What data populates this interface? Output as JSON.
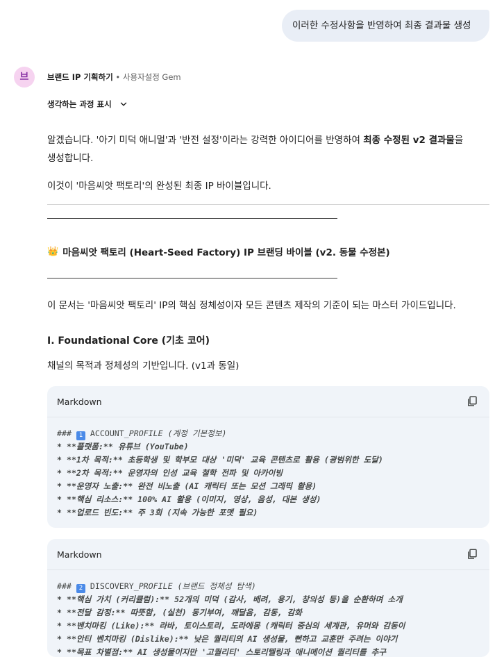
{
  "user_message": "이러한 수정사항을 반영하여 최종 결과물 생성",
  "gem": {
    "avatar_letter": "브",
    "name": "브랜드 IP 기획하기",
    "subtitle": " • 사용자설정 Gem"
  },
  "thinking_toggle": "생각하는 과정 표시",
  "response": {
    "intro_line1_part1": "알겠습니다. '아기 미덕 애니멀'과 '반전 설정'이라는 강력한 아이디어를 반영하여 ",
    "intro_line1_bold": "최종 수정된 v2 결과물",
    "intro_line1_part2": "을",
    "intro_line2": "생성합니다.",
    "intro_line3": "이것이 '마음씨앗 팩토리'의 완성된 최종 IP 바이블입니다.",
    "bible_icon": "crown-icon",
    "bible_title": "마음씨앗 팩토리 (Heart-Seed Factory) IP 브랜딩 바이블 (v2. 동물 수정본)",
    "doc_intro": "이 문서는 '마음씨앗 팩토리' IP의 핵심 정체성이자 모든 콘텐츠 제작의 기준이 되는 마스터 가이드입니다.",
    "section1_title": "Ⅰ. Foundational Core (기초 코어)",
    "section1_desc": "채널의 목적과 정체성의 기반입니다. (v1과 동일)"
  },
  "code_blocks": [
    {
      "lang": "Markdown",
      "heading_prefix": "### ",
      "badge": "1",
      "heading_text": " ACCOUNT_",
      "heading_italic": "PROFILE (계정 기본정보)",
      "lines": [
        "* **플랫폼:** 유튜브 (YouTube)",
        "* **1차 목적:** 초등학생 및 학부모 대상 '미덕' 교육 콘텐츠로 활용 (광범위한 도달)",
        "* **2차 목적:** 운영자의 인성 교육 철학 전파 및 아카이빙",
        "* **운영자 노출:** 완전 비노출 (AI 캐릭터 또는 모션 그래픽 활용)",
        "* **핵심 리소스:** 100% AI 활용 (이미지, 영상, 음성, 대본 생성)",
        "* **업로드 빈도:** 주 3회 (지속 가능한 포맷 필요)"
      ]
    },
    {
      "lang": "Markdown",
      "heading_prefix": "### ",
      "badge": "2",
      "heading_text": " DISCOVERY_",
      "heading_italic": "PROFILE (브랜드 정체성 탐색)",
      "lines": [
        "* **핵심 가치 (커리큘럼):** 52개의 미덕 (감사, 배려, 용기, 창의성 등)을 순환하며 소개",
        "* **전달 감정:** 따뜻함, (실천) 동기부여, 깨달음, 감동, 감화",
        "* **벤치마킹 (Like):** 라바, 토이스토리, 도라에몽 (캐릭터 중심의 세계관, 유머와 감동이",
        "* **안티 벤치마킹 (Dislike):** 낮은 퀄리티의 AI 생성물, 뻔하고 교훈만 주려는 이야기",
        "* **목표 차별점:** AI 생성물이지만 '고퀄리티' 스토리텔링과 애니메이션 퀄리티를 추구"
      ]
    }
  ]
}
